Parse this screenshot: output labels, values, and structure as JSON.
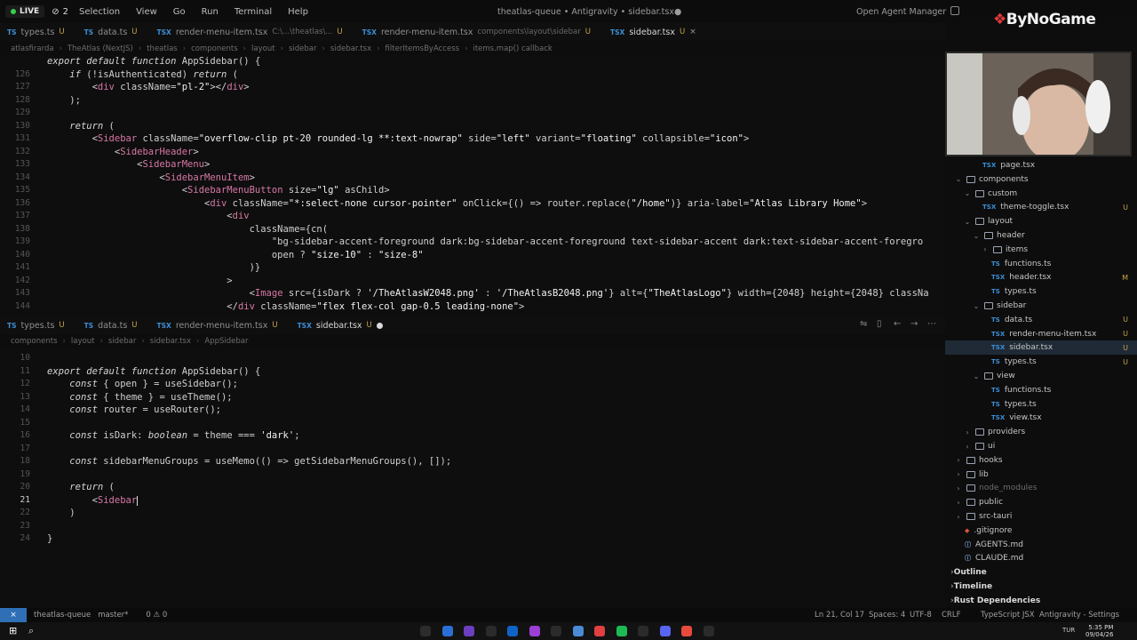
{
  "titlebar": {
    "live": "LIVE",
    "viewers": "2",
    "menu": [
      "Selection",
      "View",
      "Go",
      "Run",
      "Terminal",
      "Help"
    ],
    "window_title": "theatlas-queue • Antigravity • sidebar.tsx●",
    "open_agent_manager": "Open Agent Manager"
  },
  "top_tabs": [
    {
      "icon": "TS",
      "name": "types.ts",
      "status": "U",
      "active": false
    },
    {
      "icon": "TS",
      "name": "data.ts",
      "status": "U",
      "active": false
    },
    {
      "icon": "TSX",
      "name": "render-menu-item.tsx",
      "extra": "C:\\...\\theatlas\\...",
      "status": "U",
      "active": false
    },
    {
      "icon": "TSX",
      "name": "render-menu-item.tsx",
      "extra": "components\\layout\\sidebar",
      "status": "U",
      "active": false
    },
    {
      "icon": "TSX",
      "name": "sidebar.tsx",
      "status": "U",
      "active": true
    }
  ],
  "top_crumbs": [
    "atlasfirarda",
    "TheAtlas (NextJS)",
    "theatlas",
    "components",
    "layout",
    "sidebar",
    "sidebar.tsx",
    "filterItemsByAccess",
    "items.map() callback"
  ],
  "top_code": [
    {
      "n": "",
      "t": "export default function AppSidebar() {"
    },
    {
      "n": "126",
      "t": "    if (!isAuthenticated) return ("
    },
    {
      "n": "127",
      "t": "        <div className=\"pl-2\"></div>"
    },
    {
      "n": "128",
      "t": "    );"
    },
    {
      "n": "129",
      "t": ""
    },
    {
      "n": "130",
      "t": "    return ("
    },
    {
      "n": "131",
      "t": "        <Sidebar className=\"overflow-clip pt-20 rounded-lg **:text-nowrap\" side=\"left\" variant=\"floating\" collapsible=\"icon\">"
    },
    {
      "n": "132",
      "t": "            <SidebarHeader>"
    },
    {
      "n": "133",
      "t": "                <SidebarMenu>"
    },
    {
      "n": "134",
      "t": "                    <SidebarMenuItem>"
    },
    {
      "n": "135",
      "t": "                        <SidebarMenuButton size=\"lg\" asChild>"
    },
    {
      "n": "136",
      "t": "                            <div className=\"*:select-none cursor-pointer\" onClick={() => router.replace(\"/home\")} aria-label=\"Atlas Library Home\">"
    },
    {
      "n": "137",
      "t": "                                <div"
    },
    {
      "n": "138",
      "t": "                                    className={cn("
    },
    {
      "n": "139",
      "t": "                                        \"bg-sidebar-accent-foreground dark:bg-sidebar-accent-foreground text-sidebar-accent dark:text-sidebar-accent-foregro"
    },
    {
      "n": "140",
      "t": "                                        open ? \"size-10\" : \"size-8\""
    },
    {
      "n": "141",
      "t": "                                    )}"
    },
    {
      "n": "142",
      "t": "                                >"
    },
    {
      "n": "143",
      "t": "                                    <Image src={isDark ? '/TheAtlasW2048.png' : '/TheAtlasB2048.png'} alt={\"TheAtlasLogo\"} width={2048} height={2048} classNa"
    },
    {
      "n": "144",
      "t": "                                </div className=\"flex flex-col gap-0.5 leading-none\">"
    }
  ],
  "bottom_tabs": [
    {
      "icon": "TS",
      "name": "types.ts",
      "status": "U",
      "active": false
    },
    {
      "icon": "TS",
      "name": "data.ts",
      "status": "U",
      "active": false
    },
    {
      "icon": "TSX",
      "name": "render-menu-item.tsx",
      "status": "U",
      "active": false
    },
    {
      "icon": "TSX",
      "name": "sidebar.tsx",
      "status": "U",
      "active": true,
      "dirty": true
    }
  ],
  "bottom_crumbs": [
    "components",
    "layout",
    "sidebar",
    "sidebar.tsx",
    "AppSidebar"
  ],
  "bottom_code": [
    {
      "n": "10",
      "t": ""
    },
    {
      "n": "11",
      "t": "export default function AppSidebar() {"
    },
    {
      "n": "12",
      "t": "    const { open } = useSidebar();"
    },
    {
      "n": "13",
      "t": "    const { theme } = useTheme();"
    },
    {
      "n": "14",
      "t": "    const router = useRouter();"
    },
    {
      "n": "15",
      "t": ""
    },
    {
      "n": "16",
      "t": "    const isDark: boolean = theme === 'dark';"
    },
    {
      "n": "17",
      "t": ""
    },
    {
      "n": "18",
      "t": "    const sidebarMenuGroups = useMemo(() => getSidebarMenuGroups(), []);"
    },
    {
      "n": "19",
      "t": ""
    },
    {
      "n": "20",
      "t": "    return ("
    },
    {
      "n": "21",
      "t": "        <Sidebar",
      "current": true
    },
    {
      "n": "22",
      "t": "    )"
    },
    {
      "n": "23",
      "t": ""
    },
    {
      "n": "24",
      "t": "}"
    }
  ],
  "brand": "ByNoGame",
  "explorer": [
    {
      "depth": 3,
      "kind": "file",
      "icon": "TSX",
      "name": "page.tsx"
    },
    {
      "depth": 1,
      "kind": "folder",
      "open": true,
      "name": "components"
    },
    {
      "depth": 2,
      "kind": "folder",
      "open": true,
      "name": "custom"
    },
    {
      "depth": 3,
      "kind": "file",
      "icon": "TSX",
      "name": "theme-toggle.tsx",
      "badge": "U"
    },
    {
      "depth": 2,
      "kind": "folder",
      "open": true,
      "name": "layout"
    },
    {
      "depth": 3,
      "kind": "folder",
      "open": true,
      "name": "header"
    },
    {
      "depth": 4,
      "kind": "folder",
      "open": false,
      "name": "items"
    },
    {
      "depth": 4,
      "kind": "file",
      "icon": "TS",
      "name": "functions.ts"
    },
    {
      "depth": 4,
      "kind": "file",
      "icon": "TSX",
      "name": "header.tsx",
      "badge": "M"
    },
    {
      "depth": 4,
      "kind": "file",
      "icon": "TS",
      "name": "types.ts"
    },
    {
      "depth": 3,
      "kind": "folder",
      "open": true,
      "name": "sidebar"
    },
    {
      "depth": 4,
      "kind": "file",
      "icon": "TS",
      "name": "data.ts",
      "badge": "U"
    },
    {
      "depth": 4,
      "kind": "file",
      "icon": "TSX",
      "name": "render-menu-item.tsx",
      "badge": "U"
    },
    {
      "depth": 4,
      "kind": "file",
      "icon": "TSX",
      "name": "sidebar.tsx",
      "badge": "U",
      "selected": true
    },
    {
      "depth": 4,
      "kind": "file",
      "icon": "TS",
      "name": "types.ts",
      "badge": "U"
    },
    {
      "depth": 3,
      "kind": "folder",
      "open": true,
      "name": "view"
    },
    {
      "depth": 4,
      "kind": "file",
      "icon": "TS",
      "name": "functions.ts"
    },
    {
      "depth": 4,
      "kind": "file",
      "icon": "TS",
      "name": "types.ts"
    },
    {
      "depth": 4,
      "kind": "file",
      "icon": "TSX",
      "name": "view.tsx"
    },
    {
      "depth": 2,
      "kind": "folder",
      "open": false,
      "name": "providers"
    },
    {
      "depth": 2,
      "kind": "folder",
      "open": false,
      "name": "ui"
    },
    {
      "depth": 1,
      "kind": "folder",
      "open": false,
      "name": "hooks"
    },
    {
      "depth": 1,
      "kind": "folder",
      "open": false,
      "name": "lib"
    },
    {
      "depth": 1,
      "kind": "folder",
      "open": false,
      "name": "node_modules",
      "dim": true
    },
    {
      "depth": 1,
      "kind": "folder",
      "open": false,
      "name": "public"
    },
    {
      "depth": 1,
      "kind": "folder",
      "open": false,
      "name": "src-tauri"
    },
    {
      "depth": 1,
      "kind": "file",
      "icon": "GIT",
      "name": ".gitignore"
    },
    {
      "depth": 1,
      "kind": "file",
      "icon": "MD",
      "name": "AGENTS.md"
    },
    {
      "depth": 1,
      "kind": "file",
      "icon": "MD",
      "name": "CLAUDE.md"
    }
  ],
  "explorer_sections": [
    "Outline",
    "Timeline",
    "Rust Dependencies"
  ],
  "statusbar": {
    "branch": "theatlas-queue",
    "head": "master*",
    "problems": "0 ⚠ 0",
    "position": "Ln 21, Col 17",
    "spaces": "Spaces: 4",
    "encoding": "UTF-8",
    "eol": "CRLF",
    "language": "TypeScript JSX",
    "settings": "Antigravity - Settings"
  },
  "clock": {
    "time": "5:35 PM",
    "date": "09/04/26",
    "lang": "TUR"
  }
}
